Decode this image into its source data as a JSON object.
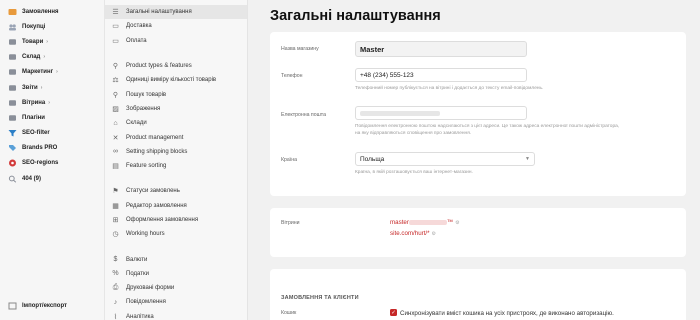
{
  "leftnav": {
    "items": [
      {
        "label": "Замовлення",
        "icon": "orders-icon",
        "chevron": false,
        "color": "#e89a3c"
      },
      {
        "label": "Покупці",
        "icon": "customers-icon",
        "chevron": false,
        "color": "#9aa4b5"
      },
      {
        "label": "Товари",
        "icon": "products-icon",
        "chevron": true,
        "color": "#8a8f99"
      },
      {
        "label": "Склад",
        "icon": "warehouse-icon",
        "chevron": true,
        "color": "#8a8f99"
      },
      {
        "label": "Маркетинг",
        "icon": "marketing-icon",
        "chevron": true,
        "color": "#8a8f99"
      },
      {
        "label": "Звіти",
        "icon": "reports-icon",
        "chevron": true,
        "color": "#8a8f99"
      },
      {
        "label": "Вітрина",
        "icon": "storefront-icon",
        "chevron": true,
        "color": "#8a8f99"
      },
      {
        "label": "Плагіни",
        "icon": "plugins-icon",
        "chevron": false,
        "color": "#8a8f99"
      },
      {
        "label": "SEO-filter",
        "icon": "filter-icon",
        "chevron": false,
        "color": "#2b7fc7"
      },
      {
        "label": "Brands PRO",
        "icon": "tag-icon",
        "chevron": false,
        "color": "#5aa0d8"
      },
      {
        "label": "SEO-regions",
        "icon": "regions-icon",
        "chevron": false,
        "color": "#d23b3b"
      },
      {
        "label": "404 (9)",
        "icon": "search-icon",
        "chevron": false,
        "color": "#8a8f99"
      }
    ],
    "bottom_label": "Імпорт/експорт"
  },
  "settingsnav": {
    "group1": [
      {
        "label": "Загальні налаштування",
        "icon": "sliders-icon",
        "glyph": "☰",
        "active": true
      },
      {
        "label": "Доставка",
        "icon": "truck-icon",
        "glyph": "▭",
        "active": false
      },
      {
        "label": "Оплата",
        "icon": "card-icon",
        "glyph": "▭",
        "active": false
      }
    ],
    "group2": [
      {
        "label": "Product types & features",
        "icon": "shapes-icon",
        "glyph": "⚲"
      },
      {
        "label": "Одиниці виміру кількості товарів",
        "icon": "ruler-icon",
        "glyph": "⚖"
      },
      {
        "label": "Пошук товарів",
        "icon": "search-icon",
        "glyph": "⚲"
      },
      {
        "label": "Зображення",
        "icon": "image-icon",
        "glyph": "▨"
      },
      {
        "label": "Склади",
        "icon": "warehouse-icon",
        "glyph": "⌂"
      },
      {
        "label": "Product management",
        "icon": "wrench-icon",
        "glyph": "✕"
      },
      {
        "label": "Setting shipping blocks",
        "icon": "link-icon",
        "glyph": "∞"
      },
      {
        "label": "Feature sorting",
        "icon": "folder-icon",
        "glyph": "▤"
      }
    ],
    "group3": [
      {
        "label": "Статуси замовлень",
        "icon": "flag-icon",
        "glyph": "⚑"
      },
      {
        "label": "Редактор замовлення",
        "icon": "edit-icon",
        "glyph": "▦"
      },
      {
        "label": "Оформлення замовлення",
        "icon": "cart-icon",
        "glyph": "⊞"
      },
      {
        "label": "Working hours",
        "icon": "clock-icon",
        "glyph": "◷"
      }
    ],
    "group4": [
      {
        "label": "Валюти",
        "icon": "currency-icon",
        "glyph": "$"
      },
      {
        "label": "Податки",
        "icon": "percent-icon",
        "glyph": "%"
      },
      {
        "label": "Друковані форми",
        "icon": "print-icon",
        "glyph": "⎙"
      },
      {
        "label": "Повідомлення",
        "icon": "bell-icon",
        "glyph": "♪"
      },
      {
        "label": "Аналітика",
        "icon": "analytics-icon",
        "glyph": "⌇"
      }
    ]
  },
  "main": {
    "title": "Загальні налаштування",
    "store_name": {
      "label": "Назва магазину",
      "value": "Master"
    },
    "phone": {
      "label": "Телефон",
      "value": "+48 (234) 555-123",
      "hint": "Телефонний номер публікується на вітрині і додається до тексту email-повідомлень."
    },
    "email": {
      "label": "Електронна пошта",
      "value": "",
      "hint1": "Повідомлення електронною поштою надсилаються з цієї адреси. Це також адреса електронної пошти адміністратора,",
      "hint2": "на яку відправляються сповіщення про замовлення."
    },
    "country": {
      "label": "Країна",
      "value": "Польща",
      "hint": "Країна, в якій розташовується ваш інтернет-магазин."
    },
    "storefronts": {
      "label": "Вітрини",
      "link1_prefix": "master",
      "link1_suffix": "™",
      "link2": "site.com/hurt/*"
    },
    "orders_section": {
      "title": "ЗАМОВЛЕННЯ ТА КЛІЄНТИ",
      "cart_label": "Кошик",
      "cart_option": "Синхронізувати вміст кошика на усіх пристроях, де виконано авторизацію."
    }
  },
  "colors": {
    "accent": "#c62828",
    "bg": "#f1f1f1",
    "card": "#ffffff"
  }
}
